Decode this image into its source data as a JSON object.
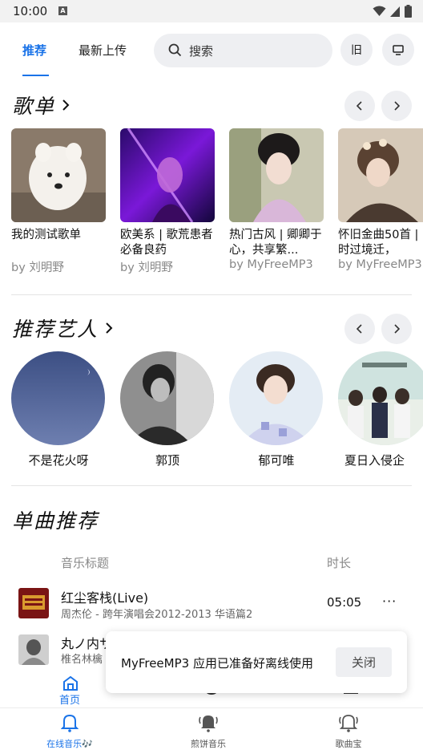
{
  "status": {
    "time": "10:00",
    "notif": "A"
  },
  "header": {
    "tabs": [
      {
        "label": "推荐"
      },
      {
        "label": "最新上传"
      }
    ],
    "search_placeholder": "搜索",
    "old_button": "旧"
  },
  "playlists": {
    "title": "歌单",
    "items": [
      {
        "title": "我的测试歌单",
        "by": "by 刘明野"
      },
      {
        "title": "欧美系 | 歌荒患者必备良药",
        "by": "by 刘明野"
      },
      {
        "title": "热门古风 | 卿卿于心，共享繁...",
        "by": "by MyFreeMP3"
      },
      {
        "title": "怀旧金曲50首 | 时过境迁，",
        "by": "by MyFreeMP3"
      }
    ]
  },
  "artists": {
    "title": "推荐艺人",
    "items": [
      {
        "name": "不是花火呀"
      },
      {
        "name": "郭顶"
      },
      {
        "name": "郁可唯"
      },
      {
        "name": "夏日入侵企"
      }
    ]
  },
  "singles": {
    "title": "单曲推荐",
    "col_title": "音乐标题",
    "col_duration": "时长",
    "songs": [
      {
        "title": "红尘客栈(Live)",
        "subtitle": "周杰伦 - 跨年演唱会2012-2013 华语篇2",
        "duration": "05:05",
        "more": "···"
      },
      {
        "title": "丸ノ内サ",
        "subtitle": "椎名林檎",
        "duration": "",
        "more": ""
      }
    ]
  },
  "ghost_nav": {
    "label": "首页"
  },
  "toast": {
    "message": "MyFreeMP3 应用已准备好离线使用",
    "close": "关闭"
  },
  "bottom_nav": [
    {
      "label": "在线音乐🎶"
    },
    {
      "label": "煎饼音乐"
    },
    {
      "label": "歌曲宝"
    }
  ],
  "colors": {
    "accent": "#1a73e8"
  }
}
